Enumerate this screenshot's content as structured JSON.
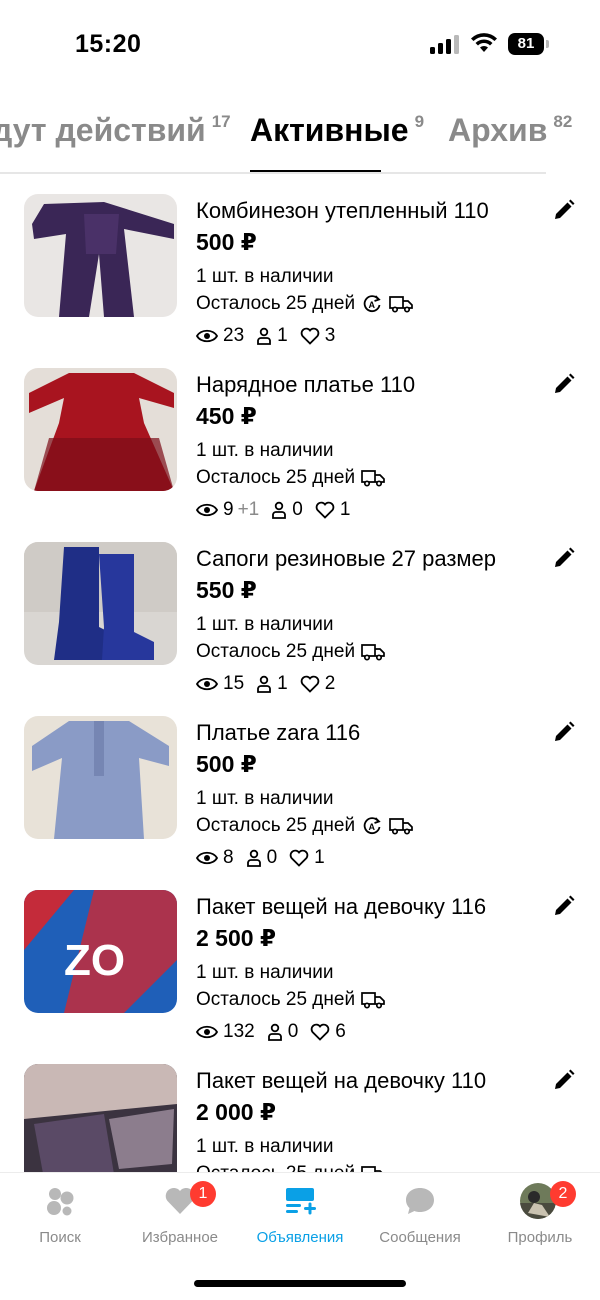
{
  "status_bar": {
    "time": "15:20",
    "battery": "81"
  },
  "tabs": [
    {
      "label": "дут действий",
      "count": "17",
      "active": false
    },
    {
      "label": "Активные",
      "count": "9",
      "active": true
    },
    {
      "label": "Архив",
      "count": "82",
      "active": false
    }
  ],
  "listings": [
    {
      "title": "Комбинезон утепленный 110",
      "price": "500 ₽",
      "stock": "1 шт. в наличии",
      "days": "Осталось 25 дней",
      "autoup": true,
      "delivery": true,
      "views": "23",
      "views_delta": "",
      "contacts": "1",
      "likes": "3"
    },
    {
      "title": "Нарядное платье 110",
      "price": "450 ₽",
      "stock": "1 шт. в наличии",
      "days": "Осталось 25 дней",
      "autoup": false,
      "delivery": true,
      "views": "9",
      "views_delta": "+1",
      "contacts": "0",
      "likes": "1"
    },
    {
      "title": "Сапоги резиновые 27 размер",
      "price": "550 ₽",
      "stock": "1 шт. в наличии",
      "days": "Осталось 25 дней",
      "autoup": false,
      "delivery": true,
      "views": "15",
      "views_delta": "",
      "contacts": "1",
      "likes": "2"
    },
    {
      "title": "Платье zara 116",
      "price": "500 ₽",
      "stock": "1 шт. в наличии",
      "days": "Осталось 25 дней",
      "autoup": true,
      "delivery": true,
      "views": "8",
      "views_delta": "",
      "contacts": "0",
      "likes": "1"
    },
    {
      "title": "Пакет вещей на девочку 116",
      "price": "2 500 ₽",
      "stock": "1 шт. в наличии",
      "days": "Осталось 25 дней",
      "autoup": false,
      "delivery": true,
      "views": "132",
      "views_delta": "",
      "contacts": "0",
      "likes": "6"
    },
    {
      "title": "Пакет вещей на девочку 110",
      "price": "2 000 ₽",
      "stock": "1 шт. в наличии",
      "days": "Осталось 25 дней",
      "autoup": false,
      "delivery": true,
      "views": "",
      "views_delta": "",
      "contacts": "",
      "likes": ""
    }
  ],
  "bottom_nav": [
    {
      "label": "Поиск",
      "icon": "search-bubbles-icon",
      "badge": ""
    },
    {
      "label": "Избранное",
      "icon": "heart-icon",
      "badge": "1"
    },
    {
      "label": "Объявления",
      "icon": "listings-add-icon",
      "badge": "",
      "active": true
    },
    {
      "label": "Сообщения",
      "icon": "chat-bubble-icon",
      "badge": ""
    },
    {
      "label": "Профиль",
      "icon": "avatar-icon",
      "badge": "2"
    }
  ],
  "colors": {
    "accent": "#0aa0e6",
    "badge": "#ff3b30",
    "muted": "#8a8a8a"
  }
}
